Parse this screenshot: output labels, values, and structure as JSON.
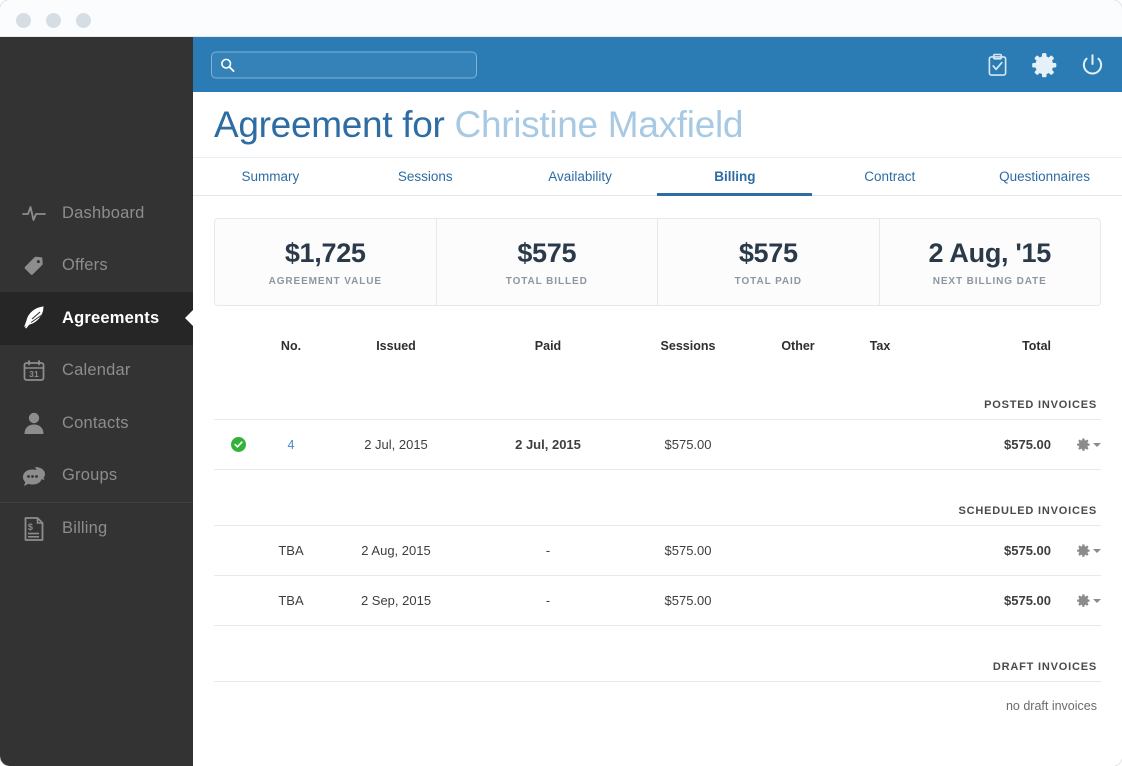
{
  "window": {
    "dots": [
      "close-dot",
      "minimize-dot",
      "maximize-dot"
    ]
  },
  "colors": {
    "header_blue": "#2b7cb5",
    "sidebar_dark": "#333333",
    "sidebar_active": "#262626",
    "title_blue": "#2e6ca4",
    "title_light_blue": "#a7c9e3",
    "stat_value": "#2b3a4a",
    "status_green": "#33b23a",
    "link_blue": "#4a87c4"
  },
  "sidebar": {
    "items": [
      {
        "label": "Dashboard",
        "icon": "activity-pulse-icon",
        "active": false
      },
      {
        "label": "Offers",
        "icon": "tag-icon",
        "active": false
      },
      {
        "label": "Agreements",
        "icon": "feather-quill-icon",
        "active": true
      },
      {
        "label": "Calendar",
        "icon": "calendar-31-icon",
        "active": false
      },
      {
        "label": "Contacts",
        "icon": "person-icon",
        "active": false
      },
      {
        "label": "Groups",
        "icon": "chat-bubbles-icon",
        "active": false
      },
      {
        "label": "Billing",
        "icon": "invoice-dollar-icon",
        "active": false
      }
    ]
  },
  "topbar": {
    "search": {
      "value": "",
      "placeholder": ""
    },
    "icons": [
      {
        "name": "clipboard-check-icon"
      },
      {
        "name": "gear-icon"
      },
      {
        "name": "power-icon"
      }
    ]
  },
  "header": {
    "title_prefix": "Agreement for ",
    "title_name": "Christine Maxfield"
  },
  "tabs": [
    {
      "label": "Summary",
      "active": false
    },
    {
      "label": "Sessions",
      "active": false
    },
    {
      "label": "Availability",
      "active": false
    },
    {
      "label": "Billing",
      "active": true
    },
    {
      "label": "Contract",
      "active": false
    },
    {
      "label": "Questionnaires",
      "active": false
    }
  ],
  "stats": [
    {
      "value": "$1,725",
      "label": "AGREEMENT VALUE"
    },
    {
      "value": "$575",
      "label": "TOTAL BILLED"
    },
    {
      "value": "$575",
      "label": "TOTAL PAID"
    },
    {
      "value": "2 Aug, '15",
      "label": "NEXT BILLING DATE"
    }
  ],
  "table": {
    "headers": {
      "status": "",
      "no": "No.",
      "issued": "Issued",
      "paid": "Paid",
      "sessions": "Sessions",
      "other": "Other",
      "tax": "Tax",
      "total": "Total",
      "menu": ""
    },
    "sections": [
      {
        "label": "POSTED INVOICES",
        "rows": [
          {
            "status": "paid-check-icon",
            "no": "4",
            "issued": "2 Jul, 2015",
            "paid": "2 Jul, 2015",
            "sessions": "$575.00",
            "other": "",
            "tax": "",
            "total": "$575.00",
            "menu": "gear-dropdown-icon"
          }
        ],
        "empty_text": ""
      },
      {
        "label": "SCHEDULED INVOICES",
        "rows": [
          {
            "status": "",
            "no": "TBA",
            "issued": "2 Aug, 2015",
            "paid": "-",
            "sessions": "$575.00",
            "other": "",
            "tax": "",
            "total": "$575.00",
            "menu": "gear-dropdown-icon"
          },
          {
            "status": "",
            "no": "TBA",
            "issued": "2 Sep, 2015",
            "paid": "-",
            "sessions": "$575.00",
            "other": "",
            "tax": "",
            "total": "$575.00",
            "menu": "gear-dropdown-icon"
          }
        ],
        "empty_text": ""
      },
      {
        "label": "DRAFT INVOICES",
        "rows": [],
        "empty_text": "no draft invoices"
      }
    ]
  }
}
